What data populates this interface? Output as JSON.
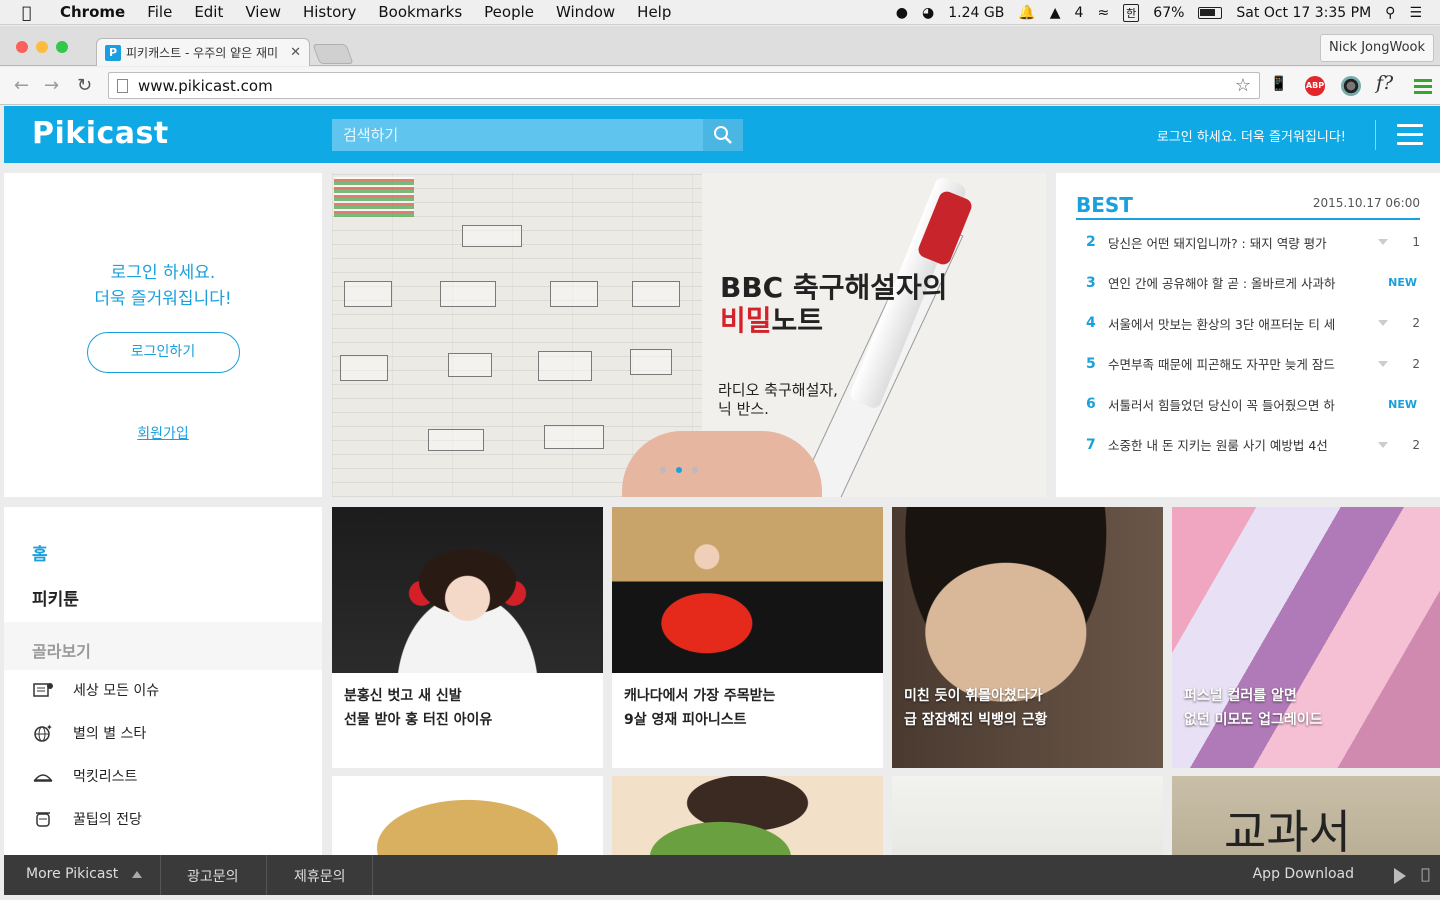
{
  "menubar": {
    "app": "Chrome",
    "items": [
      "File",
      "Edit",
      "View",
      "History",
      "Bookmarks",
      "People",
      "Window",
      "Help"
    ],
    "memory": "1.24 GB",
    "notif_count": "4",
    "battery": "67%",
    "datetime": "Sat Oct 17  3:35 PM",
    "ime": "한"
  },
  "browser": {
    "tab_title": "피키캐스트 - 우주의 얕은 재미",
    "tab_favicon": "P",
    "profile": "Nick JongWook",
    "url": "www.pikicast.com",
    "abp": "ABP",
    "fq": "f?"
  },
  "site": {
    "logo": "Pikicast",
    "search_placeholder": "검색하기",
    "header_login": "로그인 하세요. 더욱 즐거워집니다!",
    "accent": "#0fa9e6"
  },
  "login_box": {
    "line1": "로그인 하세요.",
    "line2": "더욱 즐거워집니다!",
    "login_button": "로그인하기",
    "signup_link": "회원가입"
  },
  "hero": {
    "title_line1": "BBC 축구해설자의",
    "title_red": "비밀",
    "title_rest": "노트",
    "subtitle": "라디오 축구해설자, 닉 반스."
  },
  "best": {
    "title": "BEST",
    "date": "2015.10.17 06:00",
    "items": [
      {
        "rank": "2",
        "text": "당신은 어떤 돼지입니까? : 돼지 역량 평가",
        "change": "1"
      },
      {
        "rank": "3",
        "text": "연인 간에 공유해야 할 곧 : 올바르게 사과하",
        "change": "NEW"
      },
      {
        "rank": "4",
        "text": "서울에서 맛보는 환상의 3단 애프터눈 티 세",
        "change": "2"
      },
      {
        "rank": "5",
        "text": "수면부족 때문에 피곤해도 자꾸만 늦게 잠드",
        "change": "2"
      },
      {
        "rank": "6",
        "text": "서툴러서 힘들었던 당신이 꼭 들어줬으면 하",
        "change": "NEW"
      },
      {
        "rank": "7",
        "text": "소중한 내 돈 지키는 원룸 사기 예방법 4선",
        "change": "2"
      }
    ]
  },
  "sidebar": {
    "home": "홈",
    "pikitoon": "피키툰",
    "browse": "골라보기",
    "items": [
      "세상 모든 이슈",
      "별의 별 스타",
      "먹킷리스트",
      "꿀팁의 전당"
    ]
  },
  "cards": [
    {
      "line1": "분홍신 벗고 새 신발",
      "line2": "선물 받아 홍 터진 아이유"
    },
    {
      "line1": "캐나다에서 가장 주목받는",
      "line2": "9살 영재 피아니스트"
    },
    {
      "line1": "미친 듯이 휘몰아쳤다가",
      "line2": "급 잠잠해진 빅뱅의 근황"
    },
    {
      "line1": "퍼스널 컬러를 알면",
      "line2": "없던 미모도 업그레이드"
    }
  ],
  "card4_text": "교과서",
  "footer": {
    "more": "More Pikicast",
    "ad": "광고문의",
    "partner": "제휴문의",
    "app": "App Download"
  }
}
